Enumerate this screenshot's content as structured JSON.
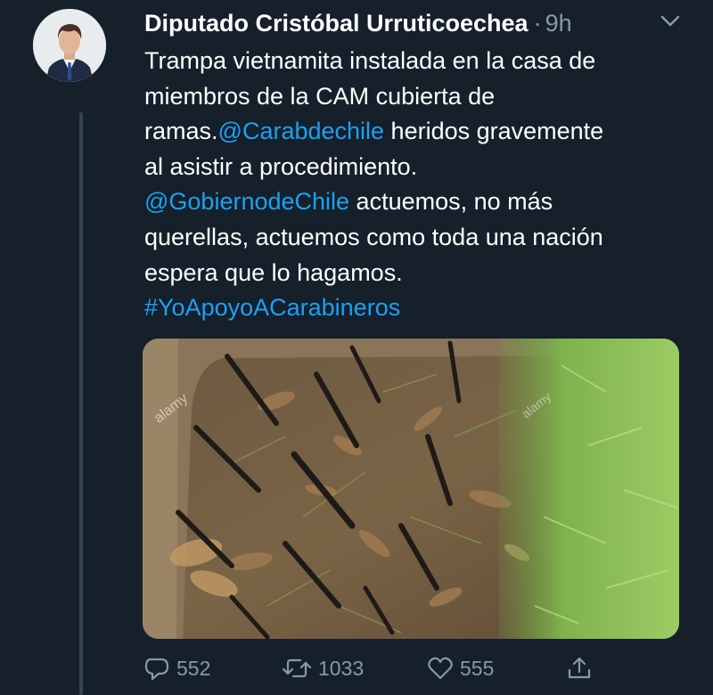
{
  "tweet": {
    "author_name": "Diputado Cristóbal Urruticoechea",
    "separator": "·",
    "time": "9h",
    "text_lines": [
      [
        {
          "t": "Trampa vietnamita instalada en la casa de"
        }
      ],
      [
        {
          "t": "miembros de la CAM cubierta de"
        }
      ],
      [
        {
          "t": "ramas."
        },
        {
          "t": "@Carabdechile",
          "link": true
        },
        {
          "t": " heridos gravemente"
        }
      ],
      [
        {
          "t": "al asistir a procedimiento."
        }
      ],
      [
        {
          "t": "@GobiernodeChile",
          "link": true
        },
        {
          "t": " actuemos, no más"
        }
      ],
      [
        {
          "t": "querellas, actuemos como toda una nación"
        }
      ],
      [
        {
          "t": "espera que lo hagamos."
        }
      ],
      [
        {
          "t": "#YoApoyoACarabineros",
          "link": true
        }
      ]
    ],
    "image_watermark": "alamy"
  },
  "actions": {
    "reply_count": "552",
    "retweet_count": "1033",
    "like_count": "555"
  },
  "colors": {
    "background": "#15202b",
    "link": "#1da1f2",
    "secondary_text": "#8899a6",
    "thread_line": "#38444d"
  },
  "icons": [
    "avatar-photo",
    "chevron-down-icon",
    "reply-icon",
    "retweet-icon",
    "like-icon",
    "share-icon"
  ]
}
